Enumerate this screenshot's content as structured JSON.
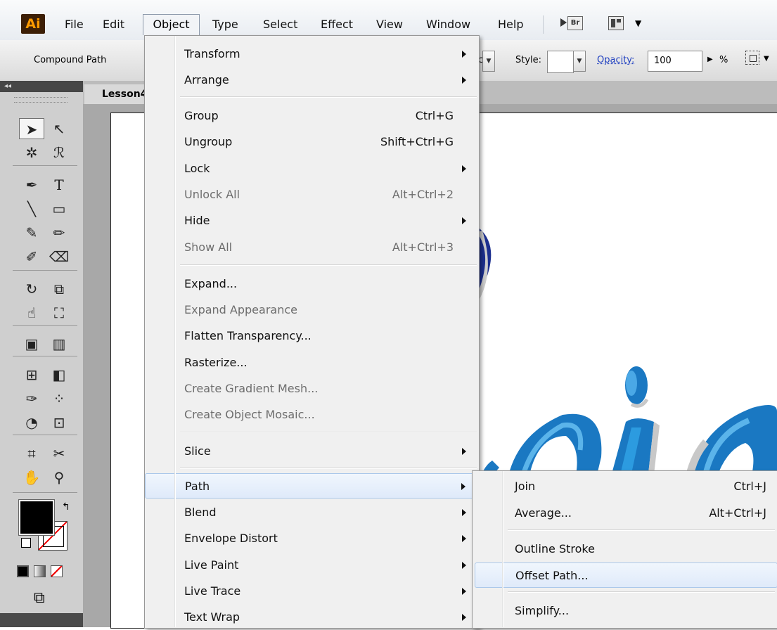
{
  "menubar": {
    "logo": "Ai",
    "items": [
      "File",
      "Edit",
      "Object",
      "Type",
      "Select",
      "Effect",
      "View",
      "Window",
      "Help"
    ],
    "bridge_label": "Br"
  },
  "controlbar": {
    "selection_type": "Compound Path",
    "left_fragment": "c",
    "style_label": "Style:",
    "opacity_label": "Opacity:",
    "opacity_value": "100",
    "percent": "%"
  },
  "document": {
    "tab_title": "Lesson4"
  },
  "object_menu": {
    "items": [
      {
        "label": "Transform",
        "shortcut": "",
        "submenu": true,
        "disabled": false
      },
      {
        "label": "Arrange",
        "shortcut": "",
        "submenu": true,
        "disabled": false
      },
      {
        "label": "Group",
        "shortcut": "Ctrl+G",
        "submenu": false,
        "disabled": false
      },
      {
        "label": "Ungroup",
        "shortcut": "Shift+Ctrl+G",
        "submenu": false,
        "disabled": false
      },
      {
        "label": "Lock",
        "shortcut": "",
        "submenu": true,
        "disabled": false
      },
      {
        "label": "Unlock All",
        "shortcut": "Alt+Ctrl+2",
        "submenu": false,
        "disabled": true
      },
      {
        "label": "Hide",
        "shortcut": "",
        "submenu": true,
        "disabled": false
      },
      {
        "label": "Show All",
        "shortcut": "Alt+Ctrl+3",
        "submenu": false,
        "disabled": true
      },
      {
        "label": "Expand...",
        "shortcut": "",
        "submenu": false,
        "disabled": false
      },
      {
        "label": "Expand Appearance",
        "shortcut": "",
        "submenu": false,
        "disabled": true
      },
      {
        "label": "Flatten Transparency...",
        "shortcut": "",
        "submenu": false,
        "disabled": false
      },
      {
        "label": "Rasterize...",
        "shortcut": "",
        "submenu": false,
        "disabled": false
      },
      {
        "label": "Create Gradient Mesh...",
        "shortcut": "",
        "submenu": false,
        "disabled": true
      },
      {
        "label": "Create Object Mosaic...",
        "shortcut": "",
        "submenu": false,
        "disabled": true
      },
      {
        "label": "Slice",
        "shortcut": "",
        "submenu": true,
        "disabled": false
      },
      {
        "label": "Path",
        "shortcut": "",
        "submenu": true,
        "disabled": false,
        "highlighted": true
      },
      {
        "label": "Blend",
        "shortcut": "",
        "submenu": true,
        "disabled": false
      },
      {
        "label": "Envelope Distort",
        "shortcut": "",
        "submenu": true,
        "disabled": false
      },
      {
        "label": "Live Paint",
        "shortcut": "",
        "submenu": true,
        "disabled": false
      },
      {
        "label": "Live Trace",
        "shortcut": "",
        "submenu": true,
        "disabled": false
      },
      {
        "label": "Text Wrap",
        "shortcut": "",
        "submenu": true,
        "disabled": false
      }
    ]
  },
  "path_submenu": {
    "items": [
      {
        "label": "Join",
        "shortcut": "Ctrl+J"
      },
      {
        "label": "Average...",
        "shortcut": "Alt+Ctrl+J"
      },
      {
        "label": "Outline Stroke",
        "shortcut": ""
      },
      {
        "label": "Offset Path...",
        "shortcut": "",
        "highlighted": true
      },
      {
        "label": "Simplify...",
        "shortcut": ""
      }
    ]
  },
  "colors": {
    "artwork_blue": "#1a78c2",
    "artwork_dark_blue": "#1c2f8f",
    "menu_highlight": "#dfeafa",
    "logo_orange": "#ff9a00"
  }
}
